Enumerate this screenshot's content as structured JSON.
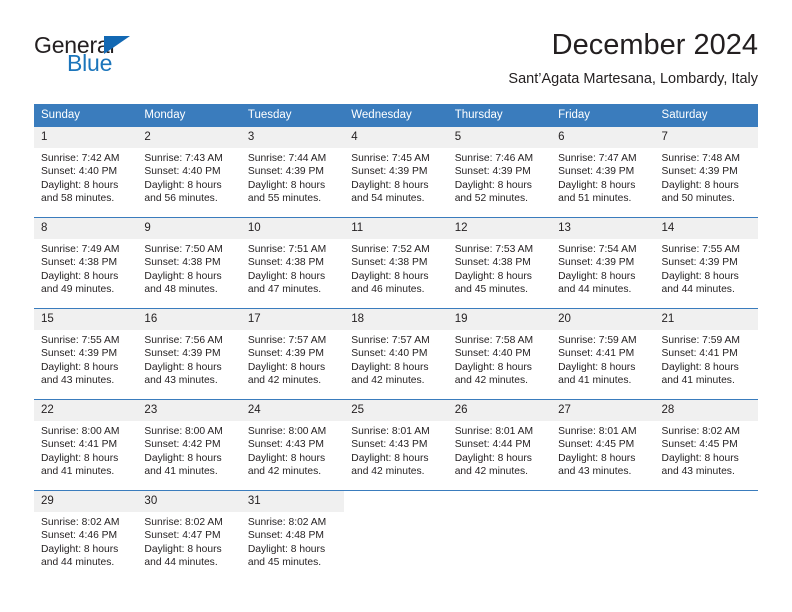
{
  "brand": {
    "name_top": "General",
    "name_bottom": "Blue",
    "color_dark": "#231f20",
    "color_blue": "#1b75bb"
  },
  "header": {
    "title": "December 2024",
    "subtitle": "Sant’Agata Martesana, Lombardy, Italy"
  },
  "theme": {
    "header_bg": "#3a7cbd",
    "daynum_bg": "#f0f0f0",
    "separator": "#3a7cbd"
  },
  "weekdays": [
    "Sunday",
    "Monday",
    "Tuesday",
    "Wednesday",
    "Thursday",
    "Friday",
    "Saturday"
  ],
  "weeks": [
    [
      {
        "day": "1",
        "sunrise": "Sunrise: 7:42 AM",
        "sunset": "Sunset: 4:40 PM",
        "daylight": "Daylight: 8 hours and 58 minutes."
      },
      {
        "day": "2",
        "sunrise": "Sunrise: 7:43 AM",
        "sunset": "Sunset: 4:40 PM",
        "daylight": "Daylight: 8 hours and 56 minutes."
      },
      {
        "day": "3",
        "sunrise": "Sunrise: 7:44 AM",
        "sunset": "Sunset: 4:39 PM",
        "daylight": "Daylight: 8 hours and 55 minutes."
      },
      {
        "day": "4",
        "sunrise": "Sunrise: 7:45 AM",
        "sunset": "Sunset: 4:39 PM",
        "daylight": "Daylight: 8 hours and 54 minutes."
      },
      {
        "day": "5",
        "sunrise": "Sunrise: 7:46 AM",
        "sunset": "Sunset: 4:39 PM",
        "daylight": "Daylight: 8 hours and 52 minutes."
      },
      {
        "day": "6",
        "sunrise": "Sunrise: 7:47 AM",
        "sunset": "Sunset: 4:39 PM",
        "daylight": "Daylight: 8 hours and 51 minutes."
      },
      {
        "day": "7",
        "sunrise": "Sunrise: 7:48 AM",
        "sunset": "Sunset: 4:39 PM",
        "daylight": "Daylight: 8 hours and 50 minutes."
      }
    ],
    [
      {
        "day": "8",
        "sunrise": "Sunrise: 7:49 AM",
        "sunset": "Sunset: 4:38 PM",
        "daylight": "Daylight: 8 hours and 49 minutes."
      },
      {
        "day": "9",
        "sunrise": "Sunrise: 7:50 AM",
        "sunset": "Sunset: 4:38 PM",
        "daylight": "Daylight: 8 hours and 48 minutes."
      },
      {
        "day": "10",
        "sunrise": "Sunrise: 7:51 AM",
        "sunset": "Sunset: 4:38 PM",
        "daylight": "Daylight: 8 hours and 47 minutes."
      },
      {
        "day": "11",
        "sunrise": "Sunrise: 7:52 AM",
        "sunset": "Sunset: 4:38 PM",
        "daylight": "Daylight: 8 hours and 46 minutes."
      },
      {
        "day": "12",
        "sunrise": "Sunrise: 7:53 AM",
        "sunset": "Sunset: 4:38 PM",
        "daylight": "Daylight: 8 hours and 45 minutes."
      },
      {
        "day": "13",
        "sunrise": "Sunrise: 7:54 AM",
        "sunset": "Sunset: 4:39 PM",
        "daylight": "Daylight: 8 hours and 44 minutes."
      },
      {
        "day": "14",
        "sunrise": "Sunrise: 7:55 AM",
        "sunset": "Sunset: 4:39 PM",
        "daylight": "Daylight: 8 hours and 44 minutes."
      }
    ],
    [
      {
        "day": "15",
        "sunrise": "Sunrise: 7:55 AM",
        "sunset": "Sunset: 4:39 PM",
        "daylight": "Daylight: 8 hours and 43 minutes."
      },
      {
        "day": "16",
        "sunrise": "Sunrise: 7:56 AM",
        "sunset": "Sunset: 4:39 PM",
        "daylight": "Daylight: 8 hours and 43 minutes."
      },
      {
        "day": "17",
        "sunrise": "Sunrise: 7:57 AM",
        "sunset": "Sunset: 4:39 PM",
        "daylight": "Daylight: 8 hours and 42 minutes."
      },
      {
        "day": "18",
        "sunrise": "Sunrise: 7:57 AM",
        "sunset": "Sunset: 4:40 PM",
        "daylight": "Daylight: 8 hours and 42 minutes."
      },
      {
        "day": "19",
        "sunrise": "Sunrise: 7:58 AM",
        "sunset": "Sunset: 4:40 PM",
        "daylight": "Daylight: 8 hours and 42 minutes."
      },
      {
        "day": "20",
        "sunrise": "Sunrise: 7:59 AM",
        "sunset": "Sunset: 4:41 PM",
        "daylight": "Daylight: 8 hours and 41 minutes."
      },
      {
        "day": "21",
        "sunrise": "Sunrise: 7:59 AM",
        "sunset": "Sunset: 4:41 PM",
        "daylight": "Daylight: 8 hours and 41 minutes."
      }
    ],
    [
      {
        "day": "22",
        "sunrise": "Sunrise: 8:00 AM",
        "sunset": "Sunset: 4:41 PM",
        "daylight": "Daylight: 8 hours and 41 minutes."
      },
      {
        "day": "23",
        "sunrise": "Sunrise: 8:00 AM",
        "sunset": "Sunset: 4:42 PM",
        "daylight": "Daylight: 8 hours and 41 minutes."
      },
      {
        "day": "24",
        "sunrise": "Sunrise: 8:00 AM",
        "sunset": "Sunset: 4:43 PM",
        "daylight": "Daylight: 8 hours and 42 minutes."
      },
      {
        "day": "25",
        "sunrise": "Sunrise: 8:01 AM",
        "sunset": "Sunset: 4:43 PM",
        "daylight": "Daylight: 8 hours and 42 minutes."
      },
      {
        "day": "26",
        "sunrise": "Sunrise: 8:01 AM",
        "sunset": "Sunset: 4:44 PM",
        "daylight": "Daylight: 8 hours and 42 minutes."
      },
      {
        "day": "27",
        "sunrise": "Sunrise: 8:01 AM",
        "sunset": "Sunset: 4:45 PM",
        "daylight": "Daylight: 8 hours and 43 minutes."
      },
      {
        "day": "28",
        "sunrise": "Sunrise: 8:02 AM",
        "sunset": "Sunset: 4:45 PM",
        "daylight": "Daylight: 8 hours and 43 minutes."
      }
    ],
    [
      {
        "day": "29",
        "sunrise": "Sunrise: 8:02 AM",
        "sunset": "Sunset: 4:46 PM",
        "daylight": "Daylight: 8 hours and 44 minutes."
      },
      {
        "day": "30",
        "sunrise": "Sunrise: 8:02 AM",
        "sunset": "Sunset: 4:47 PM",
        "daylight": "Daylight: 8 hours and 44 minutes."
      },
      {
        "day": "31",
        "sunrise": "Sunrise: 8:02 AM",
        "sunset": "Sunset: 4:48 PM",
        "daylight": "Daylight: 8 hours and 45 minutes."
      },
      {
        "day": "",
        "sunrise": "",
        "sunset": "",
        "daylight": ""
      },
      {
        "day": "",
        "sunrise": "",
        "sunset": "",
        "daylight": ""
      },
      {
        "day": "",
        "sunrise": "",
        "sunset": "",
        "daylight": ""
      },
      {
        "day": "",
        "sunrise": "",
        "sunset": "",
        "daylight": ""
      }
    ]
  ]
}
